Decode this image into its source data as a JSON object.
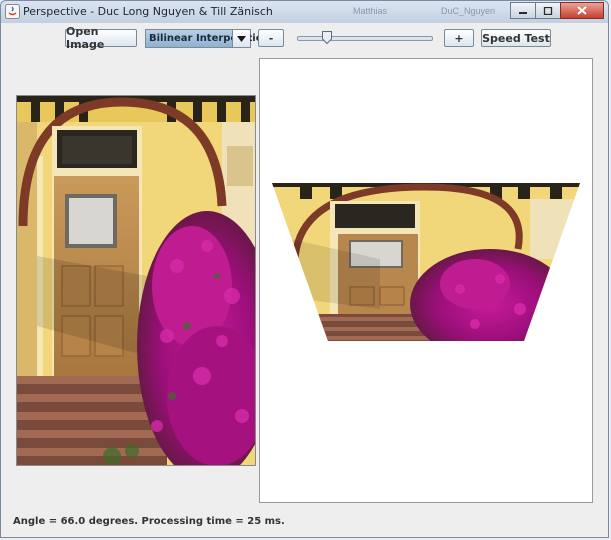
{
  "window": {
    "title": "Perspective - Duc Long Nguyen & Till Zänisch",
    "background_items": [
      "Matthias",
      "DuC_Nguyen"
    ]
  },
  "toolbar": {
    "open_image_label": "Open Image",
    "interpolation_selected": "Bilinear Interpolation",
    "minus_label": "-",
    "plus_label": "+",
    "speed_test_label": "Speed Test",
    "slider_value": 0.2
  },
  "status": {
    "text": "Angle = 66.0 degrees. Processing time = 25 ms."
  },
  "images": {
    "source": "door-with-bougainvillea-photo",
    "result": "perspective-transformed-photo"
  },
  "colors": {
    "accent": "#8fb0d1",
    "flower_magenta": "#b0148a",
    "wall_yellow": "#f2d26a",
    "door_wood": "#b8874e"
  }
}
